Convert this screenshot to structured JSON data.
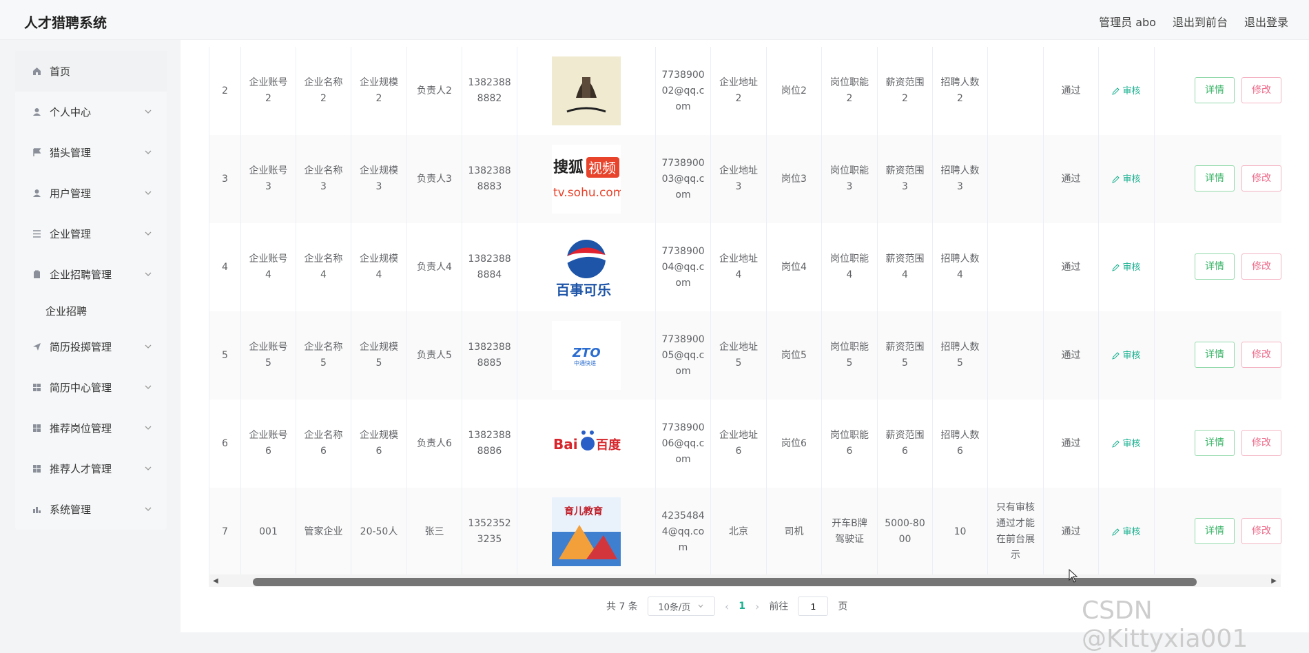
{
  "header": {
    "title": "人才猎聘系统",
    "links": [
      "管理员 abo",
      "退出到前台",
      "退出登录"
    ]
  },
  "sidebar": {
    "items": [
      {
        "label": "首页",
        "icon": "home-icon"
      },
      {
        "label": "个人中心",
        "icon": "user-icon"
      },
      {
        "label": "猎头管理",
        "icon": "flag-icon"
      },
      {
        "label": "用户管理",
        "icon": "user-icon"
      },
      {
        "label": "企业管理",
        "icon": "list-icon"
      },
      {
        "label": "企业招聘管理",
        "icon": "clipboard-icon"
      },
      {
        "label": "简历投掷管理",
        "icon": "send-icon"
      },
      {
        "label": "简历中心管理",
        "icon": "grid-icon"
      },
      {
        "label": "推荐岗位管理",
        "icon": "grid-icon"
      },
      {
        "label": "推荐人才管理",
        "icon": "grid-icon"
      },
      {
        "label": "系统管理",
        "icon": "settings-icon"
      }
    ],
    "submenu": {
      "label": "企业招聘"
    }
  },
  "table": {
    "rows": [
      {
        "index": "2",
        "account": "企业账号2",
        "name": "企业名称2",
        "scale": "企业规模2",
        "contact": "负责人2",
        "phone": "13823888882",
        "logo": "lighthouse-logo",
        "email": "773890002@qq.com",
        "address": "企业地址2",
        "position": "岗位2",
        "duty": "岗位职能2",
        "salary": "薪资范围2",
        "count": "招聘人数2",
        "remark": "",
        "status": "通过",
        "audit": "审核",
        "detail": "详情",
        "edit": "修改"
      },
      {
        "index": "3",
        "account": "企业账号3",
        "name": "企业名称3",
        "scale": "企业规模3",
        "contact": "负责人3",
        "phone": "13823888883",
        "logo": "sohu-logo",
        "email": "773890003@qq.com",
        "address": "企业地址3",
        "position": "岗位3",
        "duty": "岗位职能3",
        "salary": "薪资范围3",
        "count": "招聘人数3",
        "remark": "",
        "status": "通过",
        "audit": "审核",
        "detail": "详情",
        "edit": "修改"
      },
      {
        "index": "4",
        "account": "企业账号4",
        "name": "企业名称4",
        "scale": "企业规模4",
        "contact": "负责人4",
        "phone": "13823888884",
        "logo": "pepsi-logo",
        "email": "773890004@qq.com",
        "address": "企业地址4",
        "position": "岗位4",
        "duty": "岗位职能4",
        "salary": "薪资范围4",
        "count": "招聘人数4",
        "remark": "",
        "status": "通过",
        "audit": "审核",
        "detail": "详情",
        "edit": "修改"
      },
      {
        "index": "5",
        "account": "企业账号5",
        "name": "企业名称5",
        "scale": "企业规模5",
        "contact": "负责人5",
        "phone": "13823888885",
        "logo": "zto-logo",
        "email": "773890005@qq.com",
        "address": "企业地址5",
        "position": "岗位5",
        "duty": "岗位职能5",
        "salary": "薪资范围5",
        "count": "招聘人数5",
        "remark": "",
        "status": "通过",
        "audit": "审核",
        "detail": "详情",
        "edit": "修改"
      },
      {
        "index": "6",
        "account": "企业账号6",
        "name": "企业名称6",
        "scale": "企业规模6",
        "contact": "负责人6",
        "phone": "13823888886",
        "logo": "baidu-logo",
        "email": "773890006@qq.com",
        "address": "企业地址6",
        "position": "岗位6",
        "duty": "岗位职能6",
        "salary": "薪资范围6",
        "count": "招聘人数6",
        "remark": "",
        "status": "通过",
        "audit": "审核",
        "detail": "详情",
        "edit": "修改"
      },
      {
        "index": "7",
        "account": "001",
        "name": "管家企业",
        "scale": "20-50人",
        "contact": "张三",
        "phone": "13523523235",
        "logo": "education-logo",
        "email": "42354844@qq.com",
        "address": "北京",
        "position": "司机",
        "duty": "开车B牌驾驶证",
        "salary": "5000-8000",
        "count": "10",
        "remark": "只有审核通过才能在前台展示",
        "status": "通过",
        "audit": "审核",
        "detail": "详情",
        "edit": "修改"
      }
    ]
  },
  "pagination": {
    "total": "共 7 条",
    "page_size": "10条/页",
    "current": "1",
    "goto_prefix": "前往",
    "goto_value": "1",
    "goto_suffix": "页"
  },
  "watermark": "CSDN @Kittyxia001",
  "colors": {
    "accent": "#19b08f",
    "detail": "#3cb569",
    "edit": "#ee6b8a"
  }
}
